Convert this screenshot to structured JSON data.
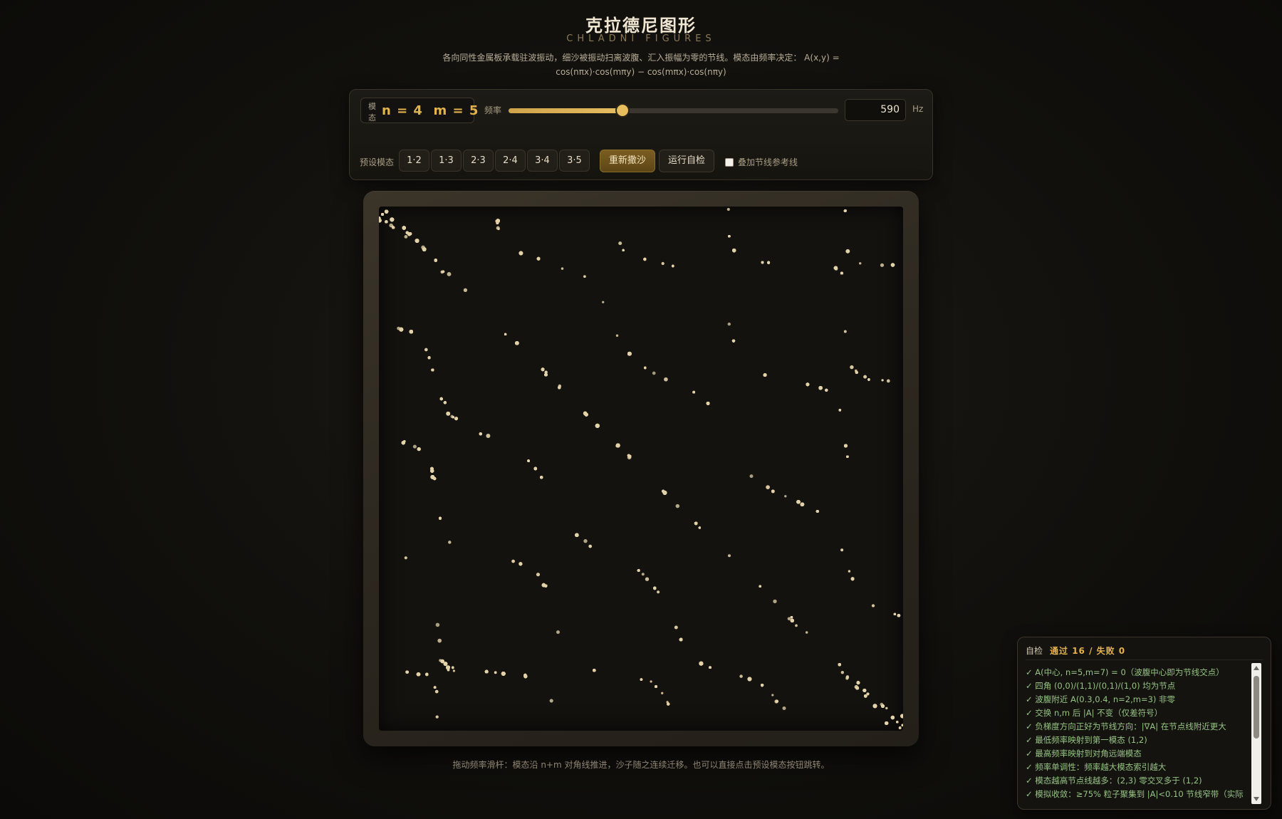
{
  "header": {
    "title": "克拉德尼图形",
    "subtitle": "CHLADNI FIGURES",
    "description": "各向同性金属板承载驻波振动，细沙被振动扫离波腹、汇入振幅为零的节线。模态由频率决定： A(x,y) = cos(nπx)·cos(mπy) − cos(mπx)·cos(nπy)"
  },
  "controls": {
    "mode_label": "模态",
    "mode_value": "n = 4  m = 5",
    "frequency_label": "频率",
    "frequency_value": "590",
    "frequency_unit": "Hz",
    "frequency_slider_fraction": 0.345,
    "preset_label": "预设模态",
    "presets": [
      "1·2",
      "1·3",
      "2·3",
      "2·4",
      "3·4",
      "3·5"
    ],
    "resprinkle_label": "重新撒沙",
    "run_selftest_label": "运行自检",
    "overlay_label": "叠加节线参考线",
    "overlay_checked": false
  },
  "plate": {
    "sand_color": "#e3d2a8",
    "mode": {
      "n": 4,
      "m": 5
    }
  },
  "hint": "拖动频率滑杆：模态沿 n+m 对角线推进，沙子随之连续迁移。也可以直接点击预设模态按钮跳转。",
  "selftest": {
    "title": "自检",
    "summary": "通过 16 / 失败 0",
    "items": [
      "✓ A(中心, n=5,m=7) = 0（波腹中心即为节线交点）",
      "✓ 四角 (0,0)/(1,1)/(0,1)/(1,0) 均为节点",
      "✓ 波腹附近 A(0.3,0.4, n=2,m=3) 非零",
      "✓ 交换 n,m 后 |A| 不变（仅差符号）",
      "✓ 负梯度方向正好为节线方向：|∇A| 在节点线附近更大",
      "✓ 最低频率映射到第一模态 (1,2)",
      "✓ 最高频率映射到对角远端模态",
      "✓ 频率单调性：频率越大模态索引越大",
      "✓ 模态越高节点线越多：(2,3) 零交叉多于 (1,2)",
      "✓ 模拟收敛：≥75% 粒子聚集到 |A|<0.10 节线窄带（实际"
    ]
  }
}
